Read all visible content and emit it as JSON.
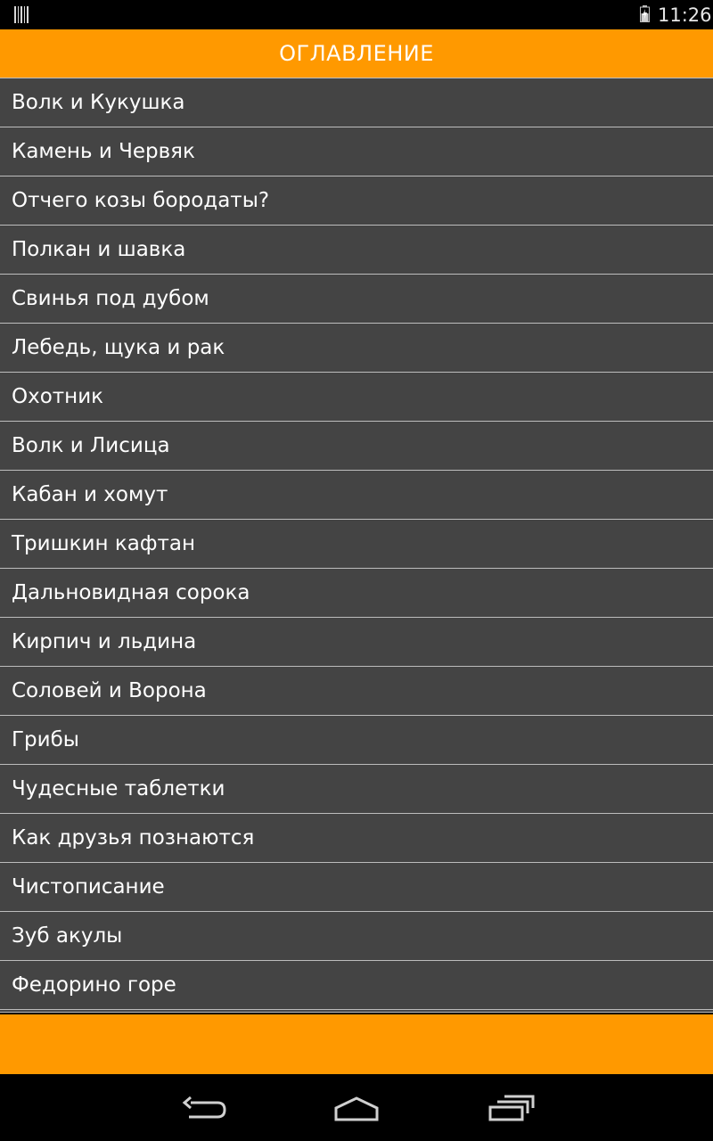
{
  "status_bar": {
    "time": "11:26",
    "left_icon": "barcode-icon",
    "battery_icon": "battery-icon"
  },
  "header": {
    "title": "ОГЛАВЛЕНИЕ"
  },
  "list": {
    "items": [
      "Волк и Кукушка",
      "Камень и Червяк",
      "Отчего козы бородаты?",
      "Полкан и шавка",
      "Свинья под дубом",
      "Лебедь, щука и рак",
      "Охотник",
      "Волк и Лисица",
      "Кабан и хомут",
      "Тришкин кафтан",
      "Дальновидная сорока",
      "Кирпич и льдина",
      "Соловей и Ворона",
      "Грибы",
      "Чудесные таблетки",
      "Как друзья познаются",
      "Чистописание",
      "Зуб акулы",
      "Федорино горе"
    ]
  },
  "nav_bar": {
    "back_icon": "back-icon",
    "home_icon": "home-icon",
    "recents_icon": "recents-icon"
  },
  "colors": {
    "accent": "#ff9900",
    "list_bg": "#444444",
    "divider": "#bdbdbd",
    "system_bar": "#000000"
  }
}
